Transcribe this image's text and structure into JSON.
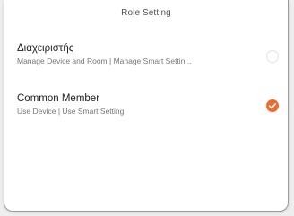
{
  "dialog": {
    "title": "Role Setting"
  },
  "roles": [
    {
      "name": "Διαχειριστής",
      "description": "Manage Device and Room | Manage Smart Settin...",
      "selected": false
    },
    {
      "name": "Common Member",
      "description": "Use Device | Use Smart Setting",
      "selected": true
    }
  ],
  "colors": {
    "accent": "#ee6a2f",
    "background": "#ffffff"
  }
}
